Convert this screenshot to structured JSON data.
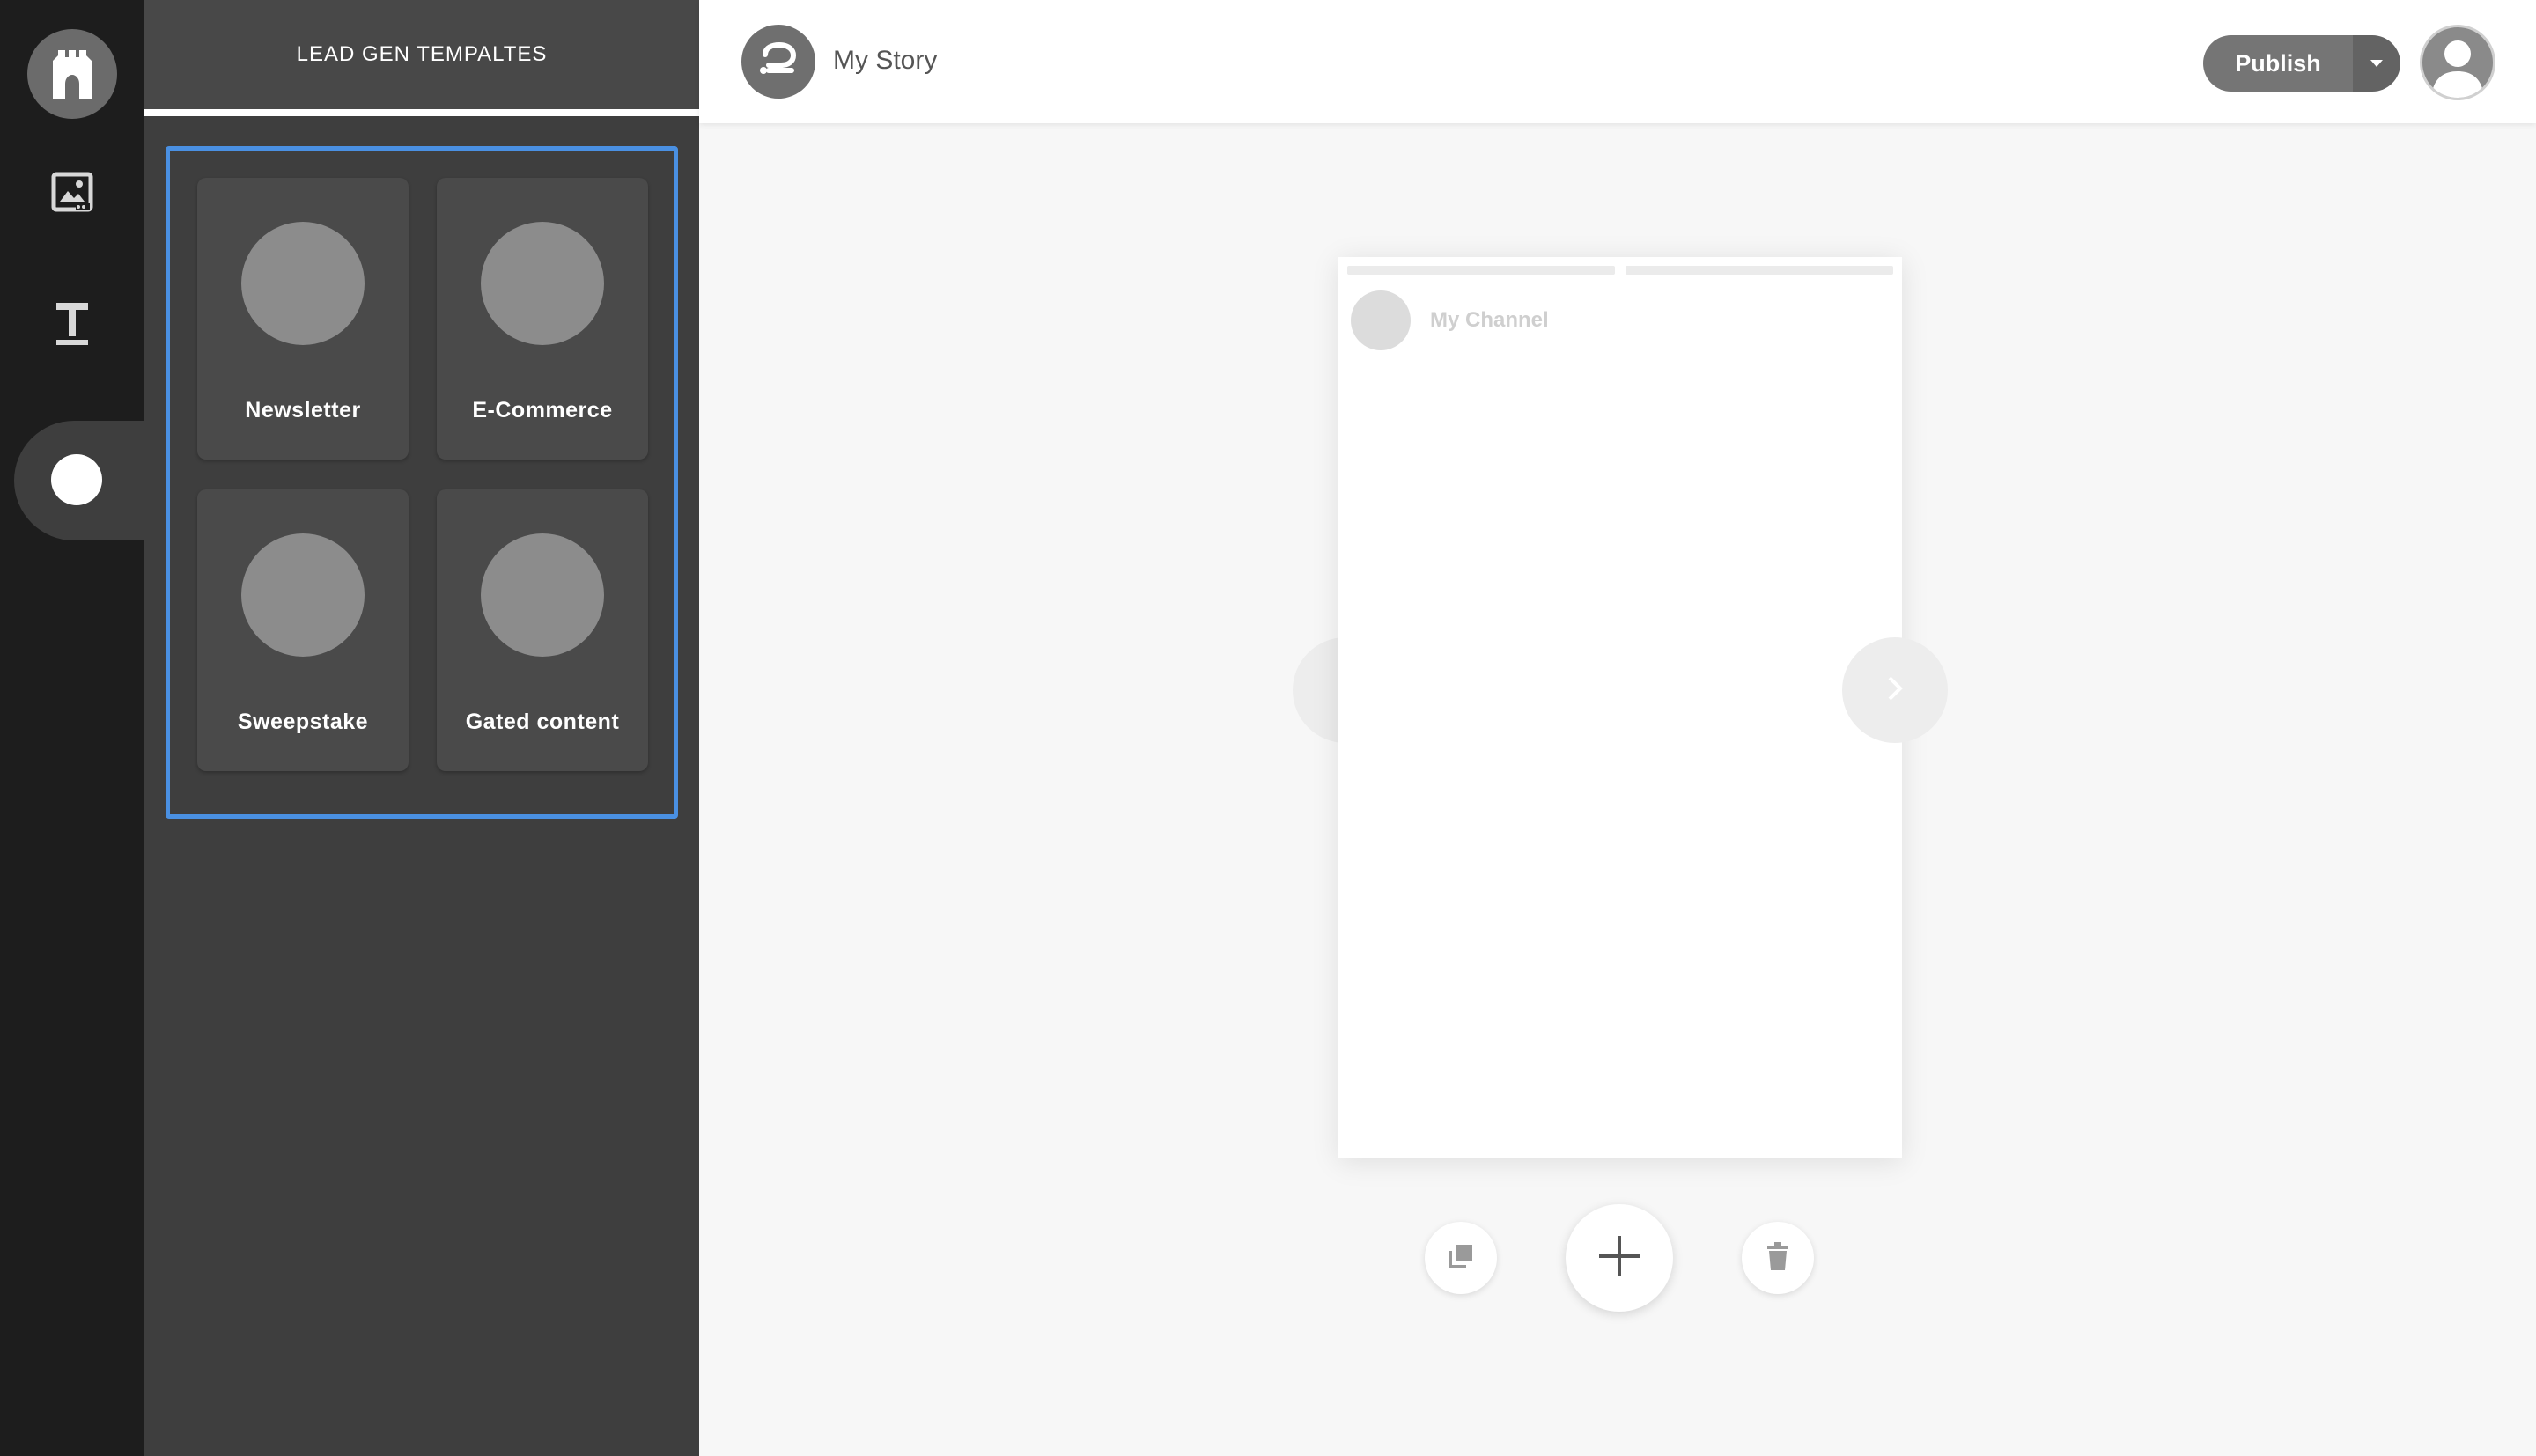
{
  "sidebar": {
    "logo_icon": "castle-logo-icon",
    "items": [
      {
        "icon": "image-icon"
      },
      {
        "icon": "text-icon"
      },
      {
        "icon": "circle-icon",
        "active": true
      }
    ]
  },
  "panel": {
    "title": "LEAD GEN TEMPALTES",
    "templates": [
      {
        "label": "Newsletter"
      },
      {
        "label": "E-Commerce"
      },
      {
        "label": "Sweepstake"
      },
      {
        "label": "Gated content"
      }
    ]
  },
  "header": {
    "story_title": "My Story",
    "publish_label": "Publish"
  },
  "story": {
    "channel_name": "My Channel"
  },
  "colors": {
    "accent": "#4a90e2",
    "rail": "#1d1d1d",
    "panel": "#3e3e3e",
    "publish": "#757575"
  }
}
